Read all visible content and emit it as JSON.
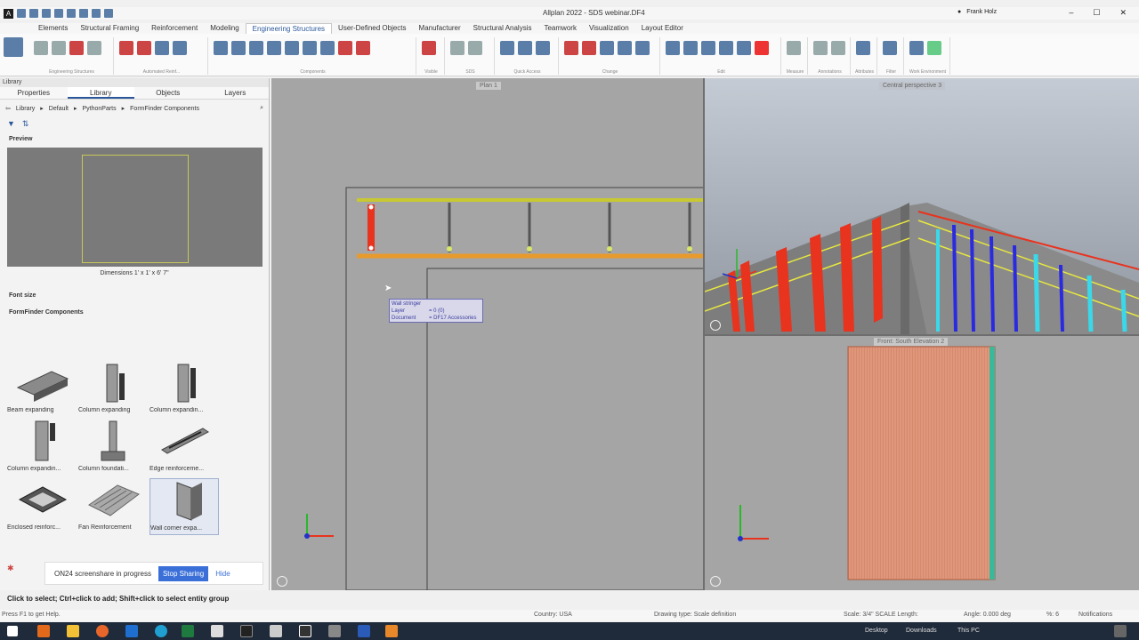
{
  "app": {
    "title": "Allplan 2022 - SDS webinar.DF4",
    "user": "Frank Holz"
  },
  "ribbon": {
    "tabs": [
      "Elements",
      "Structural Framing",
      "Reinforcement",
      "Modeling",
      "Engineering Structures",
      "User-Defined Objects",
      "Manufacturer",
      "Structural Analysis",
      "Teamwork",
      "Visualization",
      "Layout Editor"
    ],
    "active_tab": "Engineering Structures",
    "groups": [
      "Engineering Structures",
      "Automated Reinf...",
      "Components",
      "Visible",
      "SDS",
      "Quick Access",
      "Change",
      "Edit",
      "Measure",
      "Annotations",
      "Attributes",
      "Filter",
      "Work Environment"
    ]
  },
  "library": {
    "header": "Library",
    "tabs": [
      "Properties",
      "Library",
      "Objects",
      "Layers"
    ],
    "active_tab": "Library",
    "breadcrumb": [
      "Library",
      "Default",
      "PythonParts",
      "FormFinder Components"
    ],
    "preview_title": "Preview",
    "dimensions": "Dimensions     1' x 1' x 6' 7\"",
    "font_size_label": "Font size",
    "components_title": "FormFinder Components",
    "components": [
      {
        "label": "Beam expanding",
        "icon": "beam-icon"
      },
      {
        "label": "Column expanding",
        "icon": "column-icon"
      },
      {
        "label": "Column expandin...",
        "icon": "column-icon"
      },
      {
        "label": "Column expandin...",
        "icon": "column-icon"
      },
      {
        "label": "Column foundati...",
        "icon": "foundation-icon"
      },
      {
        "label": "Edge reinforceme...",
        "icon": "edge-icon"
      },
      {
        "label": "Enclosed reinforc...",
        "icon": "enclosed-icon"
      },
      {
        "label": "Fan Reinforcement",
        "icon": "fan-icon"
      },
      {
        "label": "Wall corner expa...",
        "icon": "wall-corner-icon"
      }
    ]
  },
  "share": {
    "text": "ON24 screenshare in progress",
    "stop": "Stop Sharing",
    "hide": "Hide"
  },
  "viewports": {
    "plan": "Plan 1",
    "perspective": "Central perspective 3",
    "elevation": "Front: South Elevation 2"
  },
  "tooltip": {
    "title": "Wall stringer",
    "rows": [
      {
        "key": "Layer",
        "value": "= 0 (0)"
      },
      {
        "key": "Document",
        "value": "= DF17 Accessories"
      }
    ]
  },
  "hint": "Click to select; Ctrl+click to add; Shift+click to select entity group",
  "status": {
    "help": "Press F1 to get Help.",
    "country": "Country:   USA",
    "drawing_type": "Drawing type:   Scale definition",
    "scale": "Scale:   3/4\" SCALE   Length:",
    "angle": "Angle:   0.000     deg",
    "percent": "%:   6",
    "notifications": "Notifications"
  },
  "taskbar": {
    "desktop": "Desktop",
    "downloads": "Downloads",
    "this_pc": "This PC"
  }
}
